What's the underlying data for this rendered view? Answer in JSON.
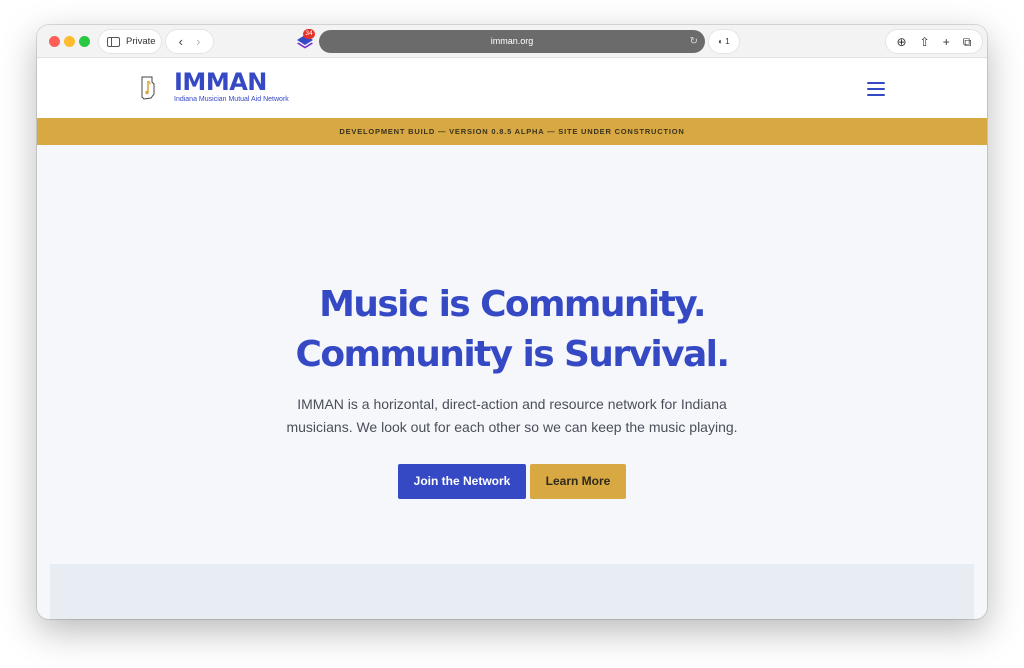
{
  "browser": {
    "private_label": "Private",
    "extension_badge": "34",
    "url": "imman.org",
    "shield_count": "1",
    "colors": {
      "url_bar": "#6b6b6b",
      "toolbar": "#f3f3f3"
    }
  },
  "site": {
    "brand_name": "IMMAN",
    "tagline": "Indiana Musician Mutual Aid Network",
    "banner": "DEVELOPMENT BUILD — VERSION 0.8.5 ALPHA — SITE UNDER CONSTRUCTION",
    "colors": {
      "primary": "#3549c4",
      "accent": "#d8a843",
      "background": "#f5f7fa"
    }
  },
  "hero": {
    "title_line1": "Music is Community.",
    "title_line2": "Community is Survival.",
    "desc_line1": "IMMAN is a horizontal, direct-action and resource network for Indiana",
    "desc_line2": "musicians. We look out for each other so we can keep the music playing.",
    "primary_button": "Join the Network",
    "secondary_button": "Learn More"
  }
}
